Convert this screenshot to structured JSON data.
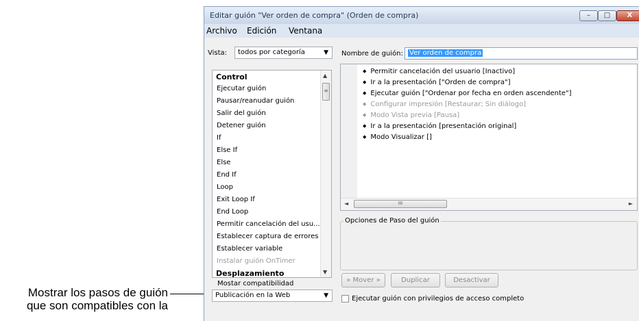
{
  "callout": {
    "line1": "Mostrar los pasos de guión",
    "line2": "que son compatibles con la"
  },
  "window": {
    "title": "Editar guión \"Ver orden de compra\" (Orden de compra)",
    "controls": {
      "minimize": "–",
      "maximize": "□",
      "close": "X"
    }
  },
  "menu": {
    "items": [
      "Archivo",
      "Edición",
      "Ventana"
    ]
  },
  "view": {
    "label": "Vista:",
    "value": "todos por categoría"
  },
  "steps_list": {
    "items": [
      {
        "text": "Control",
        "kind": "category"
      },
      {
        "text": "Ejecutar guión",
        "kind": "item"
      },
      {
        "text": "Pausar/reanudar guión",
        "kind": "item"
      },
      {
        "text": "Salir del guión",
        "kind": "item"
      },
      {
        "text": "Detener guión",
        "kind": "item"
      },
      {
        "text": "If",
        "kind": "item"
      },
      {
        "text": "Else If",
        "kind": "item"
      },
      {
        "text": "Else",
        "kind": "item"
      },
      {
        "text": "End If",
        "kind": "item"
      },
      {
        "text": "Loop",
        "kind": "item"
      },
      {
        "text": "Exit Loop If",
        "kind": "item"
      },
      {
        "text": "End Loop",
        "kind": "item"
      },
      {
        "text": "Permitir cancelación del usu...",
        "kind": "item"
      },
      {
        "text": "Establecer captura de errores",
        "kind": "item"
      },
      {
        "text": "Establecer variable",
        "kind": "item"
      },
      {
        "text": "Instalar guión OnTimer",
        "kind": "disabled"
      },
      {
        "text": "Desplazamiento",
        "kind": "category"
      }
    ]
  },
  "compat": {
    "label": "Mostar compatibilidad",
    "value": "Publicación en la Web"
  },
  "script_name": {
    "label": "Nombre de guión:",
    "value": "Ver orden de compra"
  },
  "script_steps": [
    {
      "text": "Permitir cancelación del usuario [Inactivo]",
      "disabled": false
    },
    {
      "text": "Ir a la presentación [\"Orden de compra\"]",
      "disabled": false
    },
    {
      "text": "Ejecutar guión [\"Ordenar por fecha en orden ascendente\"]",
      "disabled": false
    },
    {
      "text": "Configurar impresión [Restaurar; Sin diálogo]",
      "disabled": true
    },
    {
      "text": "Modo Vista previa [Pausa]",
      "disabled": true
    },
    {
      "text": "Ir a la presentación [presentación original]",
      "disabled": false
    },
    {
      "text": "Modo Visualizar []",
      "disabled": false
    }
  ],
  "options": {
    "legend": "Opciones de Paso del guión"
  },
  "buttons": {
    "move": "» Mover »",
    "duplicate": "Duplicar",
    "disable": "Desactivar"
  },
  "full_access": {
    "label": "Ejecutar guión con privilegios de acceso completo"
  },
  "icons": {
    "bullet": "◆",
    "dropdown": "▼",
    "up": "▲",
    "down": "▼",
    "left": "◄",
    "right": "►",
    "grip": "III",
    "vgrip": "≡"
  }
}
